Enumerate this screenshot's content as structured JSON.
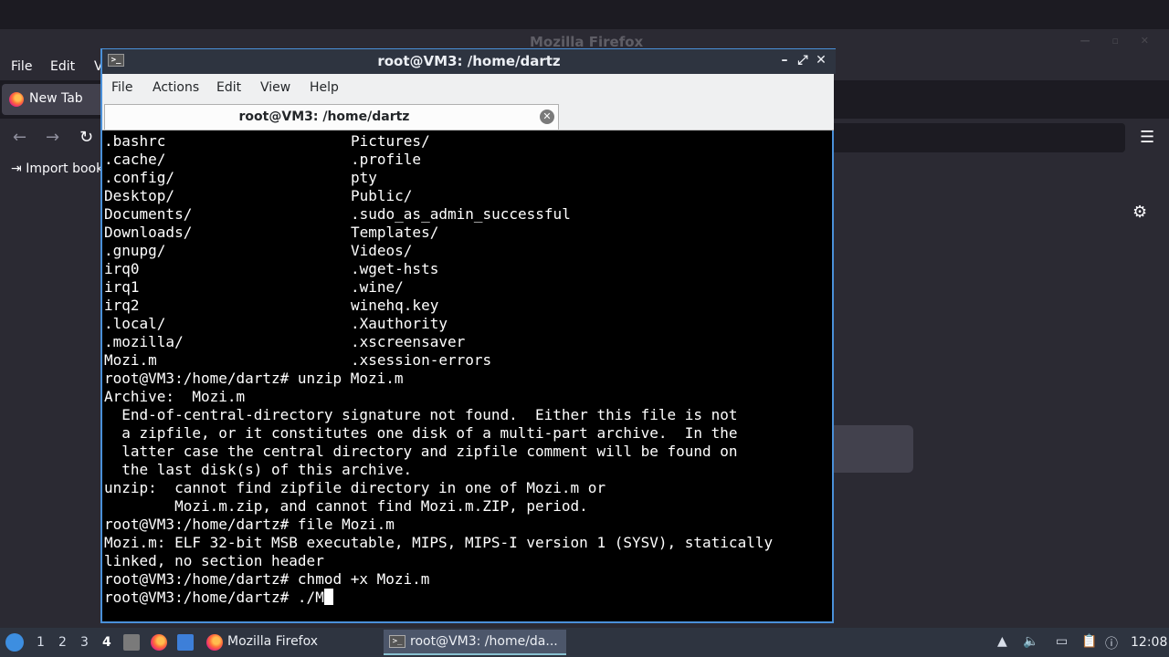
{
  "firefox": {
    "window_title": "Mozilla Firefox",
    "menu": [
      "File",
      "Edit",
      "V"
    ],
    "tab_label": "New Tab",
    "bookmark_label": "Import book",
    "colors": {
      "bg": "#2b2a33",
      "tab": "#42414d"
    }
  },
  "terminal": {
    "window_title": "root@VM3: /home/dartz",
    "menu": [
      "File",
      "Actions",
      "Edit",
      "View",
      "Help"
    ],
    "tab_label": "root@VM3: /home/dartz",
    "listing": [
      [
        ".bashrc",
        "Pictures/"
      ],
      [
        ".cache/",
        ".profile"
      ],
      [
        ".config/",
        "pty"
      ],
      [
        "Desktop/",
        "Public/"
      ],
      [
        "Documents/",
        ".sudo_as_admin_successful"
      ],
      [
        "Downloads/",
        "Templates/"
      ],
      [
        ".gnupg/",
        "Videos/"
      ],
      [
        "irq0",
        ".wget-hsts"
      ],
      [
        "irq1",
        ".wine/"
      ],
      [
        "irq2",
        "winehq.key"
      ],
      [
        ".local/",
        ".Xauthority"
      ],
      [
        ".mozilla/",
        ".xscreensaver"
      ],
      [
        "Mozi.m",
        ".xsession-errors"
      ]
    ],
    "output_lines": [
      "root@VM3:/home/dartz# unzip Mozi.m",
      "Archive:  Mozi.m",
      "  End-of-central-directory signature not found.  Either this file is not",
      "  a zipfile, or it constitutes one disk of a multi-part archive.  In the",
      "  latter case the central directory and zipfile comment will be found on",
      "  the last disk(s) of this archive.",
      "unzip:  cannot find zipfile directory in one of Mozi.m or",
      "        Mozi.m.zip, and cannot find Mozi.m.ZIP, period.",
      "root@VM3:/home/dartz# file Mozi.m",
      "Mozi.m: ELF 32-bit MSB executable, MIPS, MIPS-I version 1 (SYSV), statically",
      "linked, no section header",
      "root@VM3:/home/dartz# chmod +x Mozi.m"
    ],
    "prompt_line": "root@VM3:/home/dartz# ./M",
    "colors": {
      "bg": "#000000",
      "fg": "#ffffff",
      "frame": "#4a90d9"
    }
  },
  "taskbar": {
    "workspaces": [
      "1",
      "2",
      "3",
      "4"
    ],
    "active_workspace": "4",
    "windows": [
      {
        "label": "Mozilla Firefox",
        "icon": "firefox-icon"
      },
      {
        "label": "root@VM3: /home/da...",
        "icon": "terminal-icon"
      }
    ],
    "clock": "12:08",
    "tray_icons": [
      "up-arrow-icon",
      "volume-icon",
      "network-icon",
      "clipboard-icon",
      "update-icon"
    ]
  }
}
